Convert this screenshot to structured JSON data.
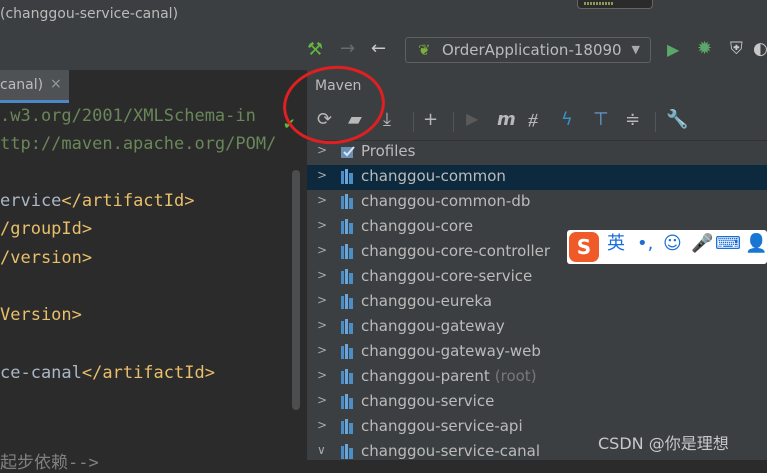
{
  "window": {
    "title": "(changgou-service-canal)"
  },
  "run_config": {
    "label": "OrderApplication-18090"
  },
  "editor": {
    "tab_label": "canal)",
    "tab_close": "×",
    "lines": [
      {
        "text": ".w3.org/2001/XMLSchema-in",
        "kind": "green"
      },
      {
        "text": "ttp://maven.apache.org/POM/",
        "kind": "green"
      },
      {
        "text": "ervice",
        "tag": "</artifactId>",
        "kind": "tag"
      },
      {
        "text": "/groupId>",
        "kind": "tagonly"
      },
      {
        "text": "/version>",
        "kind": "tagonly"
      },
      {
        "text": "Version>",
        "kind": "tagonly"
      },
      {
        "text": "ce-canal",
        "tag": "</artifactId>",
        "kind": "tag"
      },
      {
        "text": "起步依赖-->",
        "kind": "comment"
      }
    ]
  },
  "maven": {
    "title": "Maven",
    "profiles_label": "Profiles",
    "modules": [
      {
        "name": "changgou-common",
        "selected": true,
        "suffix": ""
      },
      {
        "name": "changgou-common-db",
        "selected": false,
        "suffix": ""
      },
      {
        "name": "changgou-core",
        "selected": false,
        "suffix": ""
      },
      {
        "name": "changgou-core-controller",
        "selected": false,
        "suffix": ""
      },
      {
        "name": "changgou-core-service",
        "selected": false,
        "suffix": ""
      },
      {
        "name": "changgou-eureka",
        "selected": false,
        "suffix": ""
      },
      {
        "name": "changgou-gateway",
        "selected": false,
        "suffix": ""
      },
      {
        "name": "changgou-gateway-web",
        "selected": false,
        "suffix": ""
      },
      {
        "name": "changgou-parent",
        "selected": false,
        "suffix": "(root)"
      },
      {
        "name": "changgou-service",
        "selected": false,
        "suffix": ""
      },
      {
        "name": "changgou-service-api",
        "selected": false,
        "suffix": ""
      },
      {
        "name": "changgou-service-canal",
        "selected": false,
        "suffix": ""
      }
    ]
  },
  "ime": {
    "logo": "S",
    "lang": "英",
    "punct": "•,"
  },
  "watermark": "CSDN @你是理想",
  "colors": {
    "accent": "#4a88c7",
    "selection": "#0d293e",
    "annotation": "#e02020"
  }
}
